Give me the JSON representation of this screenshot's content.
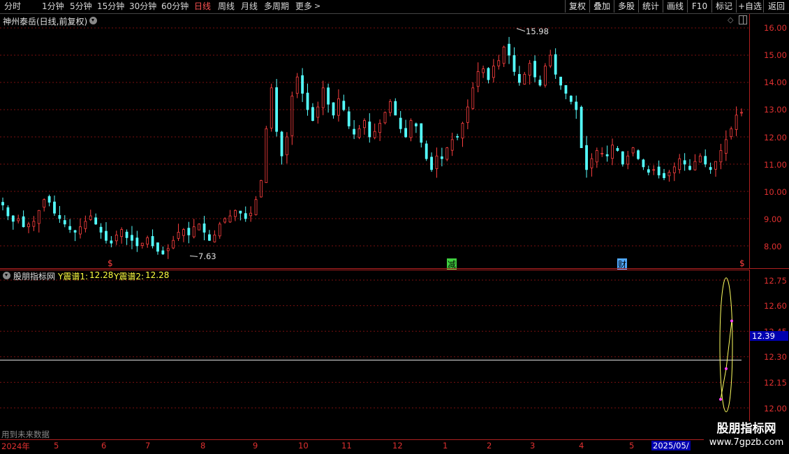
{
  "toolbar": {
    "periods": [
      "分时",
      "1分钟",
      "5分钟",
      "15分钟",
      "30分钟",
      "60分钟",
      "日线",
      "周线",
      "月线",
      "多周期",
      "更多"
    ],
    "active": "日线",
    "right": [
      "复权",
      "叠加",
      "多股",
      "统计",
      "画线",
      "F10",
      "标记",
      "+自选",
      "返回"
    ]
  },
  "main_panel": {
    "title": "神州泰岳(日线,前复权)",
    "price_axis": [
      "16.00",
      "15.00",
      "14.00",
      "13.00",
      "12.00",
      "11.00",
      "10.00",
      "9.00",
      "8.00"
    ],
    "high_marker": "15.98",
    "low_marker": "7.63",
    "markers": [
      {
        "text": "$",
        "color": "#ff4040"
      },
      {
        "text": "减",
        "color": "#40e040"
      },
      {
        "text": "财",
        "color": "#40a0ff"
      },
      {
        "text": "$",
        "color": "#ff4040"
      }
    ]
  },
  "indicator_panel": {
    "name": "股朋指标网",
    "line1_label": "Y震谱1:",
    "line1_value": "12.28",
    "line2_label": "Y震谱2:",
    "line2_value": "12.28",
    "axis": [
      "12.75",
      "12.60",
      "12.45",
      "12.30",
      "12.15",
      "12.00"
    ],
    "current_value": "12.39"
  },
  "footer": {
    "future_data_note": "用到未来数据",
    "dates": [
      "2024年",
      "5",
      "6",
      "7",
      "8",
      "9",
      "10",
      "11",
      "12",
      "1",
      "2",
      "3",
      "4",
      "5",
      "2025/05/"
    ],
    "watermark_title": "股朋指标网",
    "watermark_url": "www.7gpzb.com"
  },
  "chart_data": {
    "type": "candlestick",
    "title": "神州泰岳(日线,前复权)",
    "price_range": [
      7.3,
      16.4
    ],
    "high": 15.98,
    "low": 7.63,
    "close_path": [
      9.5,
      9.1,
      8.9,
      9.0,
      8.7,
      8.8,
      8.9,
      9.3,
      9.7,
      9.6,
      9.2,
      9.0,
      8.8,
      8.6,
      8.5,
      8.7,
      8.9,
      9.1,
      8.8,
      8.5,
      8.2,
      8.1,
      8.4,
      8.6,
      8.3,
      8.2,
      8.0,
      8.1,
      8.3,
      8.0,
      7.8,
      7.7,
      7.9,
      8.2,
      8.5,
      8.6,
      8.4,
      8.7,
      8.8,
      8.5,
      8.2,
      8.4,
      8.8,
      9.0,
      9.1,
      9.3,
      9.2,
      9.0,
      9.2,
      9.7,
      10.4,
      12.3,
      13.8,
      12.2,
      11.3,
      12.0,
      13.5,
      14.2,
      13.6,
      13.0,
      12.6,
      13.1,
      13.8,
      13.2,
      12.8,
      13.4,
      13.0,
      12.4,
      12.1,
      12.3,
      12.6,
      12.0,
      12.2,
      12.5,
      12.9,
      13.3,
      12.8,
      12.3,
      12.0,
      12.6,
      12.4,
      11.8,
      11.2,
      10.8,
      11.3,
      11.2,
      11.6,
      11.9,
      12.0,
      12.5,
      13.1,
      13.8,
      14.4,
      14.5,
      14.1,
      14.6,
      14.8,
      15.3,
      15.0,
      14.4,
      14.0,
      14.3,
      14.7,
      14.2,
      13.9,
      14.6,
      15.0,
      14.3,
      13.9,
      13.6,
      13.3,
      13.0,
      11.6,
      10.8,
      11.2,
      11.5,
      11.4,
      11.3,
      11.7,
      11.5,
      11.0,
      11.3,
      11.6,
      11.2,
      10.9,
      10.7,
      10.8,
      10.6,
      10.5,
      10.7,
      10.9,
      11.2,
      11.0,
      10.8,
      11.1,
      11.3,
      11.0,
      10.8,
      11.1,
      11.5,
      11.9,
      12.3,
      12.8,
      12.9
    ]
  }
}
